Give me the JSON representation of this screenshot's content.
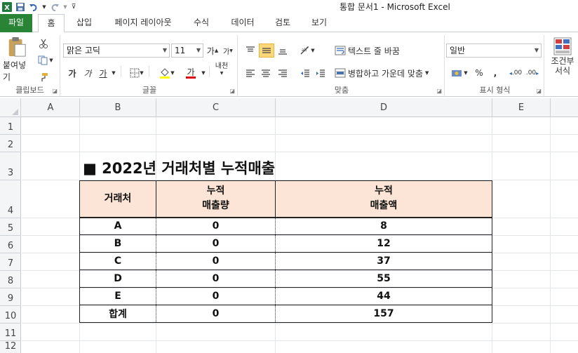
{
  "window": {
    "title": "통합 문서1 - Microsoft Excel"
  },
  "quick_access": {
    "icons": [
      "excel-icon",
      "save-icon",
      "undo-icon",
      "redo-icon",
      "customize-icon"
    ]
  },
  "tabs": {
    "file": "파일",
    "home": "홈",
    "insert": "삽입",
    "page_layout": "페이지 레이아웃",
    "formulas": "수식",
    "data": "데이터",
    "review": "검토",
    "view": "보기"
  },
  "ribbon": {
    "clipboard": {
      "label": "클립보드",
      "paste": "붙여넣기"
    },
    "font": {
      "label": "글꼴",
      "font_name": "맑은 고딕",
      "font_size": "11",
      "bold": "가",
      "italic": "가",
      "underline": "가",
      "grow": "가",
      "shrink": "가",
      "font_color_glyph": "가",
      "phonetic": "내천"
    },
    "alignment": {
      "label": "맞춤",
      "wrap_text": "텍스트 줄 바꿈",
      "merge_center": "병합하고 가운데 맞춤"
    },
    "number": {
      "label": "표시 형식",
      "format": "일반",
      "percent": "%",
      "comma": ",",
      "inc_decimal": ".00",
      "dec_decimal": ".00"
    },
    "styles": {
      "conditional": "조건부",
      "conditional2": "서식"
    }
  },
  "columns": [
    "A",
    "B",
    "C",
    "D",
    "E"
  ],
  "rows": [
    "1",
    "2",
    "3",
    "4",
    "5",
    "6",
    "7",
    "8",
    "9",
    "10",
    "11",
    "12"
  ],
  "sheet": {
    "title": "■ 2022년 거래처별 누적매출",
    "table": {
      "headers": {
        "client": "거래처",
        "qty_line1": "누적",
        "qty_line2": "매출량",
        "amt_line1": "누적",
        "amt_line2": "매출액"
      },
      "rows": [
        {
          "client": "A",
          "qty": "0",
          "amount": "8"
        },
        {
          "client": "B",
          "qty": "0",
          "amount": "12"
        },
        {
          "client": "C",
          "qty": "0",
          "amount": "37"
        },
        {
          "client": "D",
          "qty": "0",
          "amount": "55"
        },
        {
          "client": "E",
          "qty": "0",
          "amount": "44"
        }
      ],
      "total": {
        "client": "합계",
        "qty": "0",
        "amount": "157"
      }
    }
  },
  "colors": {
    "file_tab": "#2a8436",
    "header_fill": "#fce4d6",
    "active_align": "#fcd779"
  }
}
